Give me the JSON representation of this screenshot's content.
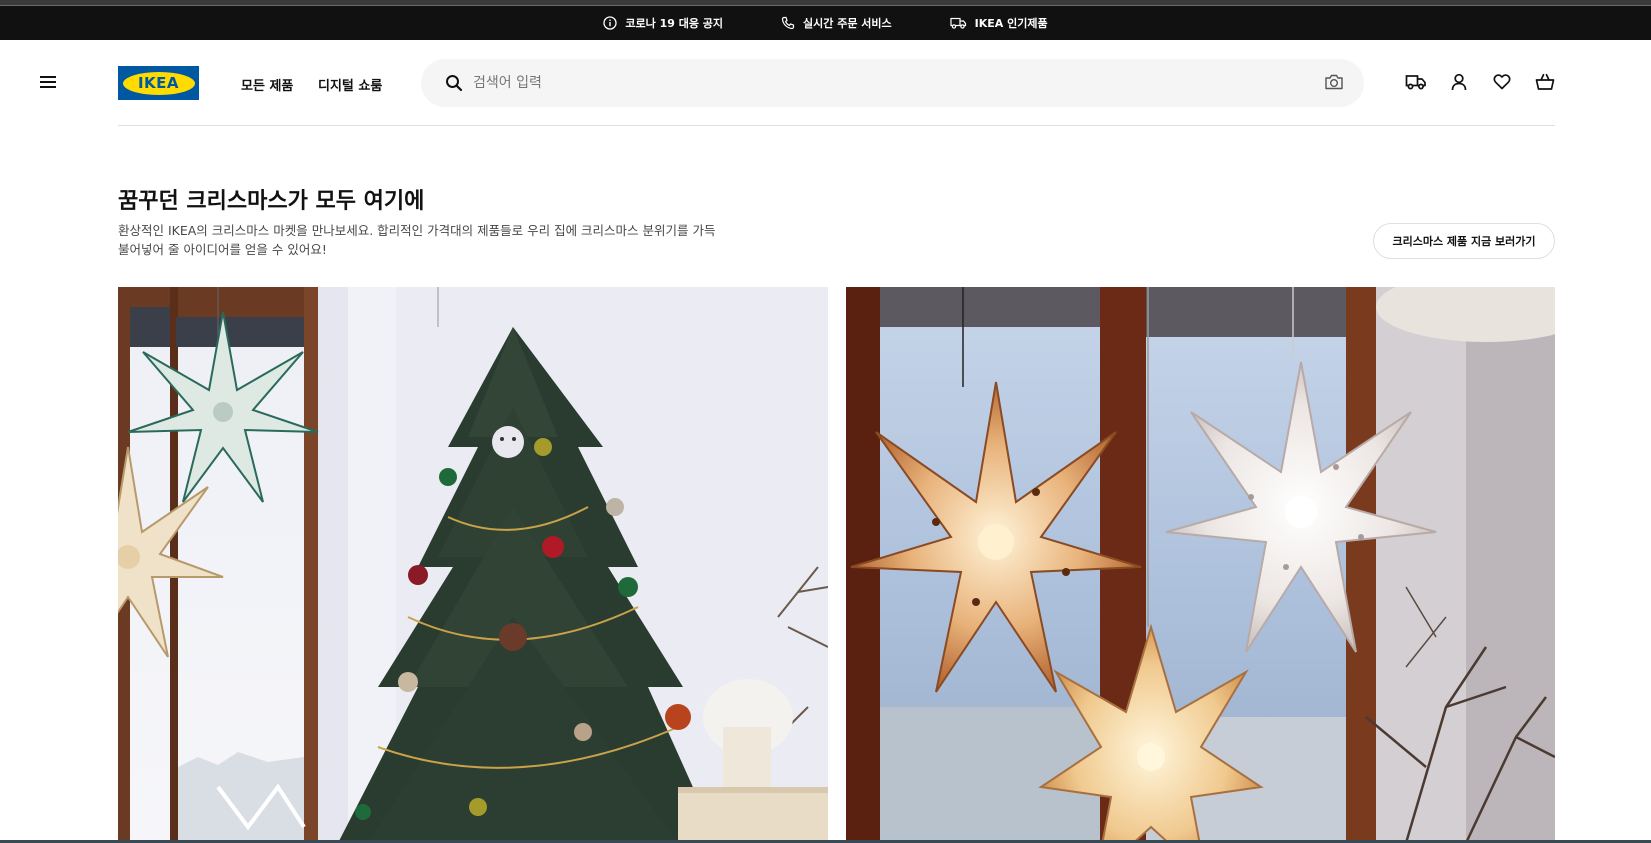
{
  "notice_bar": {
    "items": [
      {
        "label": "코로나 19 대응 공지",
        "icon": "info-icon"
      },
      {
        "label": "실시간 주문 서비스",
        "icon": "phone-icon"
      },
      {
        "label": "IKEA 인기제품",
        "icon": "truck-icon"
      }
    ]
  },
  "header": {
    "logo_text": "IKEA",
    "nav": {
      "all_products": "모든 제품",
      "digital_showroom": "디지털 쇼룸"
    },
    "search": {
      "placeholder": "검색어 입력",
      "value": ""
    },
    "icons": [
      "hamburger-menu-icon",
      "delivery-icon",
      "user-icon",
      "heart-icon",
      "shopping-bag-icon"
    ]
  },
  "promo": {
    "title": "꿈꾸던 크리스마스가 모두 여기에",
    "description_line1": "환상적인 IKEA의 크리스마스 마켓을 만나보세요. 합리적인 가격대의 제품들로 우리 집에 크리스마스 분위기를 가득",
    "description_line2": "불어넣어 줄 아이디어를 얻을 수 있어요!",
    "button_label": "크리스마스 제품 지금 보러가기"
  },
  "colors": {
    "brand_blue": "#0058a3",
    "brand_yellow": "#ffdb00",
    "notice_bg": "#111111",
    "search_bg": "#f5f5f5"
  }
}
